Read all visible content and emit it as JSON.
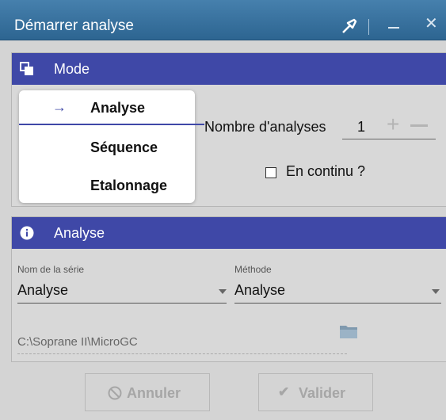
{
  "window": {
    "title": "Démarrer analyse"
  },
  "mode": {
    "title": "Mode",
    "tabs": [
      {
        "label": "Analyse",
        "active": true
      },
      {
        "label": "Séquence",
        "active": false
      },
      {
        "label": "Etalonnage",
        "active": false
      }
    ],
    "count_label": "Nombre d'analyses",
    "count_value": "1",
    "continuous_label": "En continu ?",
    "continuous_checked": false
  },
  "analyse": {
    "title": "Analyse",
    "series_name_label": "Nom de la série",
    "series_name_value": "Analyse",
    "method_label": "Méthode",
    "method_value": "Analyse",
    "path": "C:\\Soprane II\\MicroGC"
  },
  "buttons": {
    "cancel": "Annuler",
    "validate": "Valider"
  },
  "colors": {
    "titlebar": "#2d6591",
    "header": "#3f48a7",
    "background": "#d4d4d4"
  },
  "icons": {
    "pin": "pin-icon",
    "minimize": "minimize-icon",
    "close": "close-icon",
    "mode": "layers-icon",
    "info": "info-icon",
    "arrow": "arrow-right-icon",
    "folder": "folder-icon",
    "cancel": "cancel-circle-icon",
    "validate": "check-icon"
  }
}
